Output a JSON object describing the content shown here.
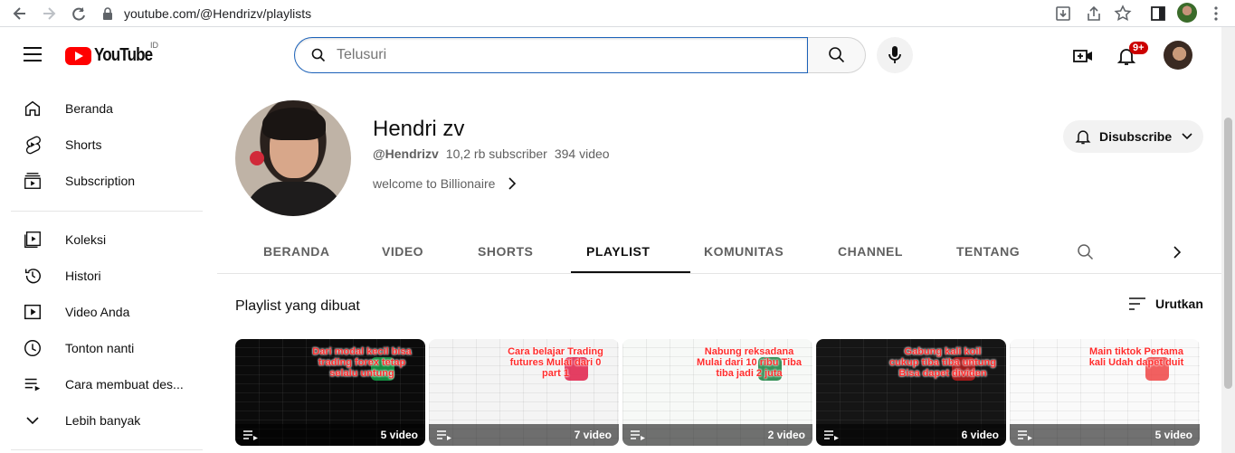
{
  "browser": {
    "url": "youtube.com/@Hendrizv/playlists"
  },
  "header": {
    "logo_text": "YouTube",
    "country_code": "ID",
    "search_placeholder": "Telusuri",
    "notification_count": "9+"
  },
  "sidebar": {
    "items": [
      {
        "label": "Beranda",
        "icon": "home-icon"
      },
      {
        "label": "Shorts",
        "icon": "shorts-icon"
      },
      {
        "label": "Subscription",
        "icon": "subscriptions-icon"
      },
      {
        "label": "Koleksi",
        "icon": "library-icon"
      },
      {
        "label": "Histori",
        "icon": "history-icon"
      },
      {
        "label": "Video Anda",
        "icon": "your-videos-icon"
      },
      {
        "label": "Tonton nanti",
        "icon": "watch-later-icon"
      },
      {
        "label": "Cara membuat des...",
        "icon": "playlist-icon"
      },
      {
        "label": "Lebih banyak",
        "icon": "chevron-down-icon"
      }
    ]
  },
  "channel": {
    "name": "Hendri zv",
    "handle": "@Hendrizv",
    "subscribers": "10,2 rb subscriber",
    "video_count": "394 video",
    "description": "welcome to Billionaire",
    "subscribe_label": "Disubscribe"
  },
  "tabs": [
    {
      "label": "BERANDA"
    },
    {
      "label": "VIDEO"
    },
    {
      "label": "SHORTS"
    },
    {
      "label": "PLAYLIST",
      "active": true
    },
    {
      "label": "KOMUNITAS"
    },
    {
      "label": "CHANNEL"
    },
    {
      "label": "TENTANG"
    }
  ],
  "playlists_section": {
    "title": "Playlist yang dibuat",
    "sort_label": "Urutkan"
  },
  "playlists": [
    {
      "caption": "Dari modal kecil bisa trading forex tetap selalu untung",
      "count": "5 video",
      "bg": "#0b0b0b",
      "accent": "#16a34a"
    },
    {
      "caption": "Cara belajar Trading futures Mulai dari 0 part 1",
      "count": "7 video",
      "bg": "#f4f4f4",
      "accent": "#e11d48"
    },
    {
      "caption": "Nabung reksadana Mulai dari 10 ribu Tiba tiba jadi 2 juta",
      "count": "2 video",
      "bg": "#f7f9f7",
      "accent": "#15803d"
    },
    {
      "caption": "Gabung kali koil cukup tiba tiba untung Bisa dapet dividen",
      "count": "6 video",
      "bg": "#151515",
      "accent": "#b91c1c"
    },
    {
      "caption": "Main tiktok Pertama kali Udah dapet duit",
      "count": "5 video",
      "bg": "#fafafa",
      "accent": "#ef4444"
    }
  ]
}
